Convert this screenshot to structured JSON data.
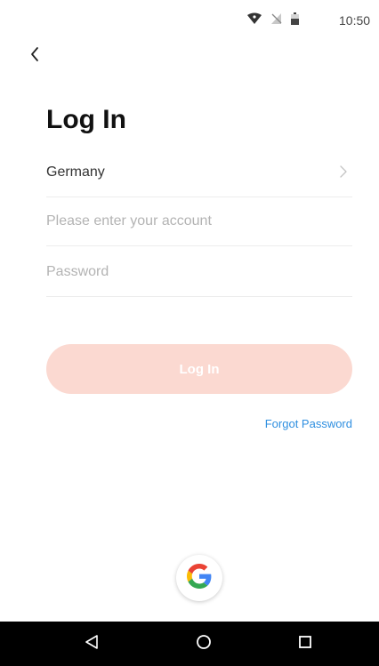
{
  "status_bar": {
    "time": "10:50",
    "icons": [
      "wifi-icon",
      "no-signal-icon",
      "battery-icon"
    ]
  },
  "header": {
    "back_icon": "chevron-left-icon"
  },
  "form": {
    "title": "Log In",
    "country": {
      "value": "Germany",
      "icon": "chevron-right-icon"
    },
    "account": {
      "value": "",
      "placeholder": "Please enter your account"
    },
    "password": {
      "value": "",
      "placeholder": "Password"
    },
    "submit_label": "Log In",
    "forgot_label": "Forgot Password"
  },
  "social": {
    "google_icon": "google-icon"
  },
  "nav_bar": {
    "icons": [
      "nav-back-icon",
      "nav-home-icon",
      "nav-recents-icon"
    ]
  },
  "colors": {
    "button_bg": "#fbd9d1",
    "link": "#2f8fe0",
    "title": "#111111",
    "placeholder": "#b3b3b3"
  }
}
